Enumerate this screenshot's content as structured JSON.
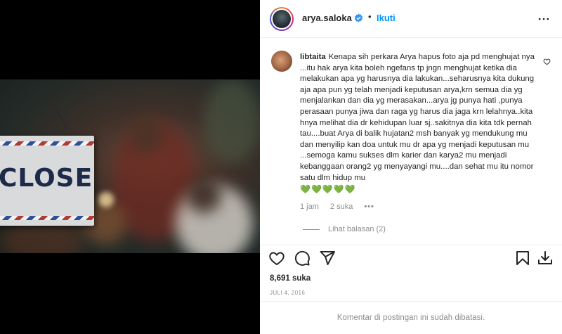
{
  "post": {
    "username": "arya.saloka",
    "separator": "•",
    "follow_label": "Ikuti",
    "verified": true
  },
  "media": {
    "sign_text": "CLOSED"
  },
  "comment": {
    "username": "libtaita",
    "text": "Kenapa sih perkara Arya hapus foto aja pd menghujat nya ...itu hak arya kita boleh ngefans tp jngn menghujat ketika dia melakukan apa yg harusnya dia lakukan...seharusnya kita dukung aja apa pun yg telah menjadi keputusan arya,krn semua dia yg menjalankan dan dia yg merasakan...arya jg punya hati ,punya perasaan punya jiwa dan raga yg harus dia jaga krn lelahnya..kita hnya melihat dia dr kehidupan luar sj..sakitnya dia kita tdk pernah tau....buat Arya di balik hujatan2 msh banyak yg mendukung mu dan menyilip kan doa untuk mu dr apa yg menjadi keputusan mu ...semoga kamu sukses dlm karier dan karya2 mu menjadi kebanggaan orang2 yg menyayangi mu....dan sehat mu itu nomor satu dlm hidup mu",
    "hearts": "💚💚💚💚💚",
    "time": "1 jam",
    "likes": "2 suka",
    "more_label": "•••",
    "view_replies": "Lihat balasan (2)"
  },
  "stats": {
    "likes": "8,691 suka",
    "date": "JULI 4, 2016"
  },
  "footer": {
    "comments_disabled": "Komentar di postingan ini sudah dibatasi."
  },
  "icons": {
    "like": "heart-icon",
    "comment": "comment-icon",
    "share": "share-icon",
    "save": "bookmark-icon",
    "download": "download-icon",
    "more": "more-options-icon"
  },
  "colors": {
    "accent": "#0095f6",
    "verified": "#3897f0",
    "muted": "#8e8e8e",
    "hearts": "#2ecc40"
  }
}
